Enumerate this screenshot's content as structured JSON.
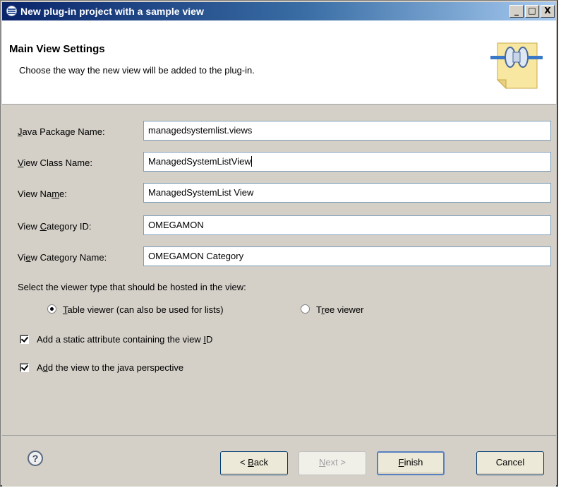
{
  "window": {
    "title": "New plug-in project with a sample view",
    "controls": [
      "_",
      "□",
      "X"
    ]
  },
  "header": {
    "heading": "Main View Settings",
    "description": "Choose the way the new view will be added to the plug-in.",
    "icon": "plug-connector-icon"
  },
  "form": {
    "fields": [
      {
        "label_pre": "",
        "label_key": "J",
        "label_post": "ava Package Name:",
        "value": "managedsystemlist.views"
      },
      {
        "label_pre": "",
        "label_key": "V",
        "label_post": "iew Class Name:",
        "value": "ManagedSystemListView"
      },
      {
        "label_pre": "View Na",
        "label_key": "m",
        "label_post": "e:",
        "value": "ManagedSystemList View"
      },
      {
        "label_pre": "View ",
        "label_key": "C",
        "label_post": "ategory ID:",
        "value": "OMEGAMON"
      },
      {
        "label_pre": "Vi",
        "label_key": "e",
        "label_post": "w Category Name:",
        "value": "OMEGAMON Category"
      }
    ]
  },
  "viewer": {
    "prompt": "Select the viewer type that should be hosted in the view:",
    "table_pre": "",
    "table_key": "T",
    "table_post": "able viewer (can also be used for lists)",
    "tree_pre": "T",
    "tree_key": "r",
    "tree_post": "ee viewer",
    "selected": "table"
  },
  "options": {
    "static_attr_pre": "Add a static attribute containing the view ",
    "static_attr_key": "I",
    "static_attr_post": "D",
    "perspective_pre": "A",
    "perspective_key": "d",
    "perspective_post": "d the view to the java perspective"
  },
  "buttons": {
    "help": "?",
    "back_pre": "< ",
    "back_key": "B",
    "back_post": "ack",
    "next_pre": "",
    "next_key": "N",
    "next_post": "ext >",
    "finish_pre": "",
    "finish_key": "F",
    "finish_post": "inish",
    "cancel": "Cancel"
  }
}
